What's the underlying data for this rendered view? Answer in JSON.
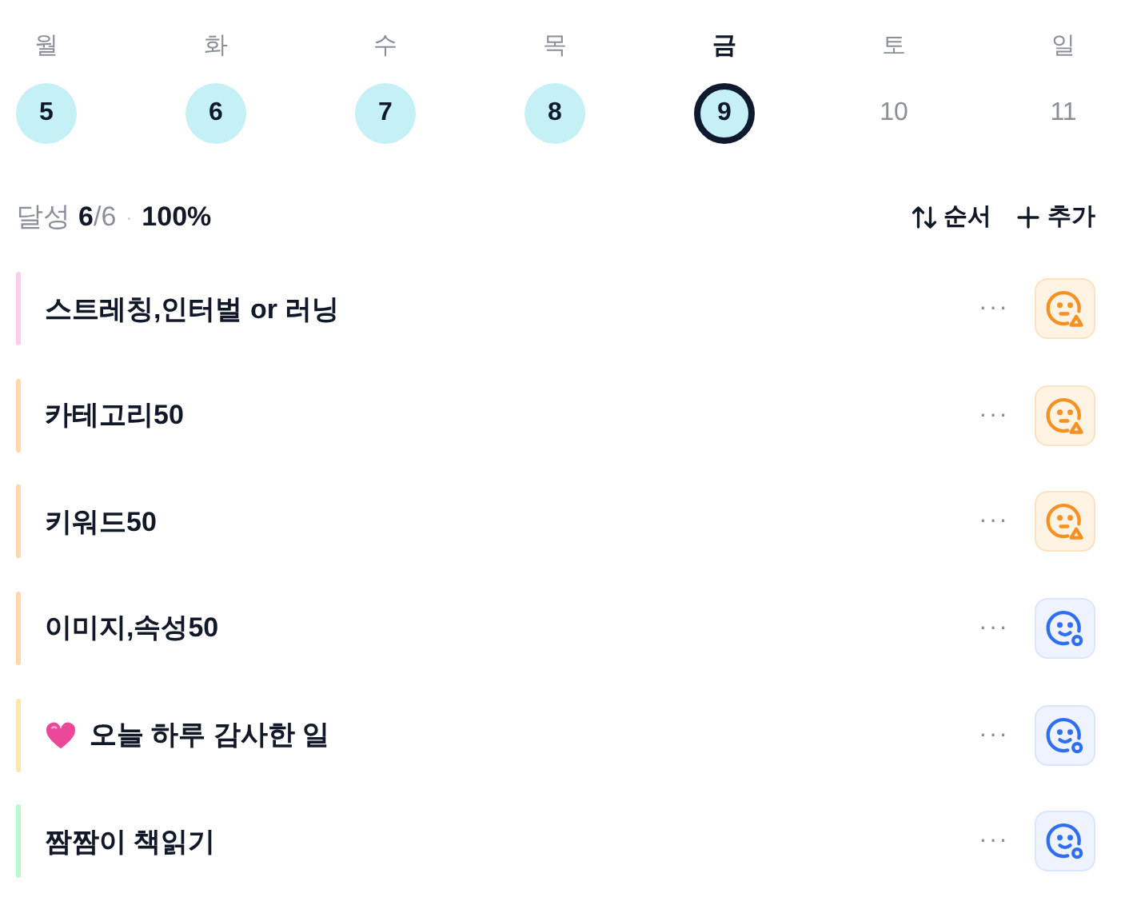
{
  "week": [
    {
      "weekday": "월",
      "date": "5",
      "done": true,
      "selected": false
    },
    {
      "weekday": "화",
      "date": "6",
      "done": true,
      "selected": false
    },
    {
      "weekday": "수",
      "date": "7",
      "done": true,
      "selected": false
    },
    {
      "weekday": "목",
      "date": "8",
      "done": true,
      "selected": false
    },
    {
      "weekday": "금",
      "date": "9",
      "done": true,
      "selected": true
    },
    {
      "weekday": "토",
      "date": "10",
      "done": false,
      "selected": false
    },
    {
      "weekday": "일",
      "date": "11",
      "done": false,
      "selected": false
    }
  ],
  "summary": {
    "label": "달성",
    "done": "6",
    "total": "/6",
    "separator": "·",
    "percent": "100%"
  },
  "actions": [
    {
      "kind": "sort",
      "label": "순서"
    },
    {
      "kind": "add",
      "label": "추가"
    }
  ],
  "tasks": [
    {
      "title": "스트레칭,인터벌 or 러닝",
      "color": "#fbcfe8",
      "heart": false,
      "more": "···",
      "warning": true
    },
    {
      "title": "카테고리50",
      "color": "#fed7aa",
      "heart": false,
      "more": "···",
      "warning": true
    },
    {
      "title": "키워드50",
      "color": "#fed7aa",
      "heart": false,
      "more": "···",
      "warning": true
    },
    {
      "title": "이미지,속성50",
      "color": "#fed7aa",
      "heart": false,
      "more": "···",
      "warning": false
    },
    {
      "title": "오늘 하루 감사한 일",
      "color": "#fde6b0",
      "heart": true,
      "more": "···",
      "warning": false
    },
    {
      "title": "짬짬이 책읽기",
      "color": "#bbf7d0",
      "heart": false,
      "more": "···",
      "warning": false
    }
  ]
}
